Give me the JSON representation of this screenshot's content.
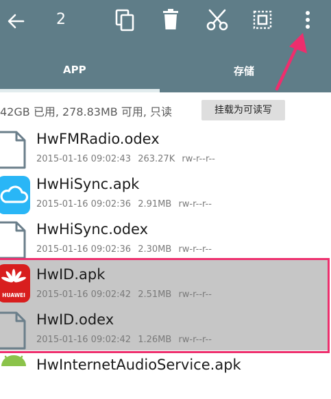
{
  "toolbar": {
    "selected_count": "2",
    "icons": [
      "back-arrow-icon",
      "copy-icon",
      "delete-icon",
      "cut-icon",
      "select-all-icon",
      "more-vert-icon"
    ]
  },
  "tabs": [
    {
      "label": "APP"
    },
    {
      "label": "存储"
    }
  ],
  "storage": {
    "info": "42GB 已用, 278.83MB 可用, 只读",
    "mount_button": "挂载为可读写"
  },
  "files": [
    {
      "name": "HwFMRadio.odex",
      "date": "2015-01-16 09:02:43",
      "size": "263.27K",
      "perm": "rw-r--r--",
      "icon": "file-icon",
      "selected": false
    },
    {
      "name": "HwHiSync.apk",
      "date": "2015-01-16 09:02:36",
      "size": "2.91MB",
      "perm": "rw-r--r--",
      "icon": "cloud-app-icon",
      "selected": false
    },
    {
      "name": "HwHiSync.odex",
      "date": "2015-01-16 09:02:36",
      "size": "2.30MB",
      "perm": "rw-r--r--",
      "icon": "file-icon",
      "selected": false
    },
    {
      "name": "HwID.apk",
      "date": "2015-01-16 09:02:42",
      "size": "2.51MB",
      "perm": "rw-r--r--",
      "icon": "huawei-app-icon",
      "selected": true
    },
    {
      "name": "HwID.odex",
      "date": "2015-01-16 09:02:42",
      "size": "1.26MB",
      "perm": "rw-r--r--",
      "icon": "file-icon",
      "selected": true
    },
    {
      "name": "HwInternetAudioService.apk",
      "date": "",
      "size": "",
      "perm": "",
      "icon": "android-app-icon",
      "selected": false
    }
  ],
  "huawei_logo_text": "HUAWEI",
  "colors": {
    "toolbar": "#5f7d88",
    "selection": "#c6c6c6",
    "annotation": "#ee2e6d",
    "cloud_app": "#29b6f6",
    "huawei_red": "#d81e1e"
  }
}
